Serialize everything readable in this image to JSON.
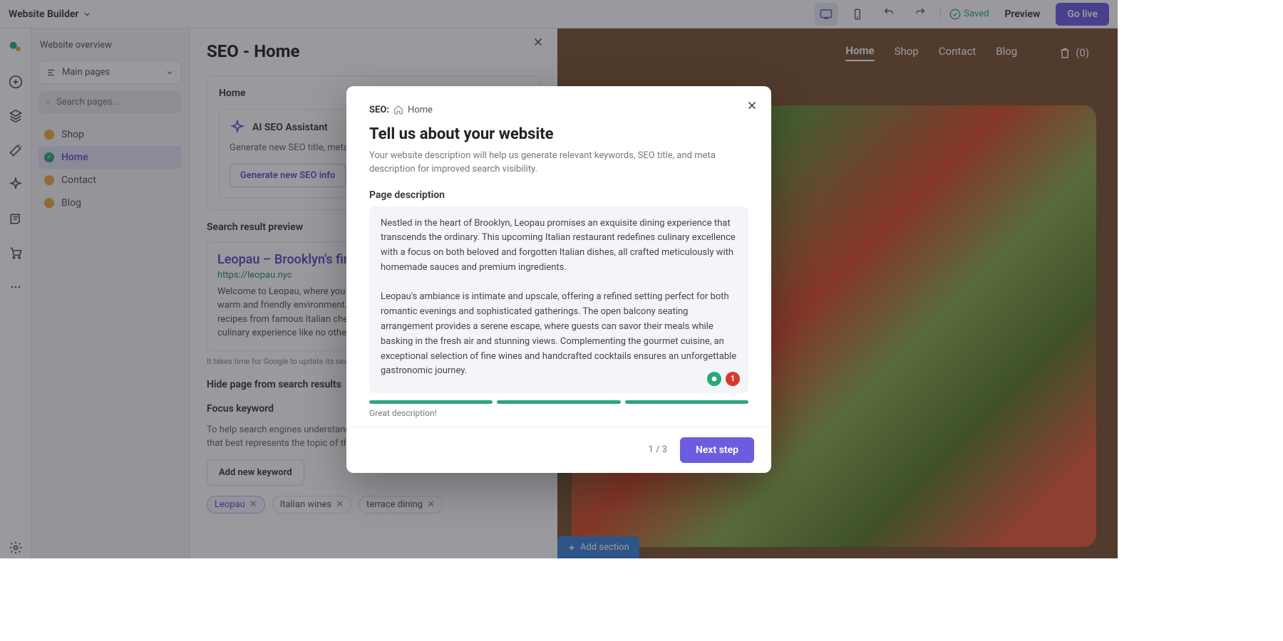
{
  "topbar": {
    "brand": "Website Builder",
    "saved": "Saved",
    "preview": "Preview",
    "golive": "Go live"
  },
  "sidebar": {
    "overview": "Website overview",
    "group": "Main pages",
    "search_placeholder": "Search pages...",
    "items": [
      {
        "label": "Shop",
        "status": "yellow"
      },
      {
        "label": "Home",
        "status": "green",
        "active": true
      },
      {
        "label": "Contact",
        "status": "yellow"
      },
      {
        "label": "Blog",
        "status": "yellow"
      }
    ]
  },
  "seo": {
    "title": "SEO - Home",
    "home_label": "Home",
    "ai": {
      "title": "AI SEO Assistant",
      "desc": "Generate new SEO title, meta description, and keywords for this page",
      "button": "Generate new SEO info"
    },
    "serp": {
      "heading": "Search result preview",
      "title": "Leopau – Brooklyn's finest Italian dining",
      "url": "https://leopau.nyc",
      "desc": "Welcome to Leopau, where you can enjoy a traditional Italian meal in a warm and friendly environment. We use only the freshest ingredients and recipes from famous Italian chefs to create our dishes. Join us for a culinary experience like no other.",
      "note": "It takes time for Google to update its search results."
    },
    "hide_heading": "Hide page from search results",
    "focus": {
      "heading": "Focus keyword",
      "desc": "To help search engines understand your content, choose a word or keyphrase that best represents the topic of this page",
      "add": "Add new keyword",
      "chips": [
        "Leopau",
        "Italian wines",
        "terrace dining"
      ]
    }
  },
  "site": {
    "nav": [
      "Home",
      "Shop",
      "Contact",
      "Blog"
    ],
    "cart_count": "(0)",
    "add_section": "Add section"
  },
  "modal": {
    "bc_label": "SEO:",
    "bc_page": "Home",
    "heading": "Tell us about your website",
    "sub": "Your website description will help us generate relevant keywords, SEO title, and meta description for improved search visibility.",
    "field_label": "Page description",
    "textarea": "Nestled in the heart of Brooklyn, Leopau promises an exquisite dining experience that transcends the ordinary. This upcoming Italian restaurant redefines culinary excellence with a focus on both beloved and forgotten Italian dishes, all crafted meticulously with homemade sauces and premium ingredients.\n\nLeopau's ambiance is intimate and upscale, offering a refined setting perfect for both romantic evenings and sophisticated gatherings. The open balcony seating arrangement provides a serene escape, where guests can savor their meals while basking in the fresh air and stunning views. Complementing the gourmet cuisine, an exceptional selection of fine wines and handcrafted cocktails ensures an unforgettable gastronomic journey.\n\nDiscover the essence of Italy at Leopau, where tradition meets luxury.",
    "grammar_count": "1",
    "strength_label": "Great description!",
    "step": "1 / 3",
    "next": "Next step"
  }
}
